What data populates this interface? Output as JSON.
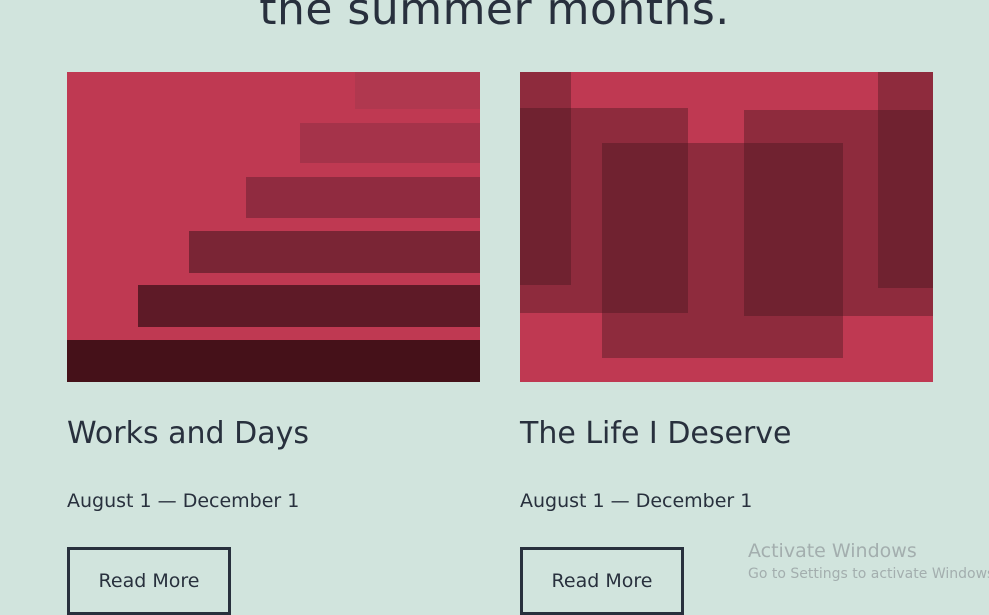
{
  "page": {
    "headline": "the summer months."
  },
  "cards": [
    {
      "title": "Works and Days",
      "date": "August 1 — December 1",
      "button_label": "Read More",
      "image": "abstract-steps-illustration"
    },
    {
      "title": "The Life I Deserve",
      "date": "August 1 — December 1",
      "button_label": "Read More",
      "image": "abstract-overlapping-rectangles-illustration"
    }
  ],
  "watermark": {
    "title": "Activate Windows",
    "subtitle": "Go to Settings to activate Windows."
  },
  "colors": {
    "background": "#d1e4dd",
    "text": "#28303d",
    "image_base": "#bf3952",
    "image_dark": "#451119"
  }
}
